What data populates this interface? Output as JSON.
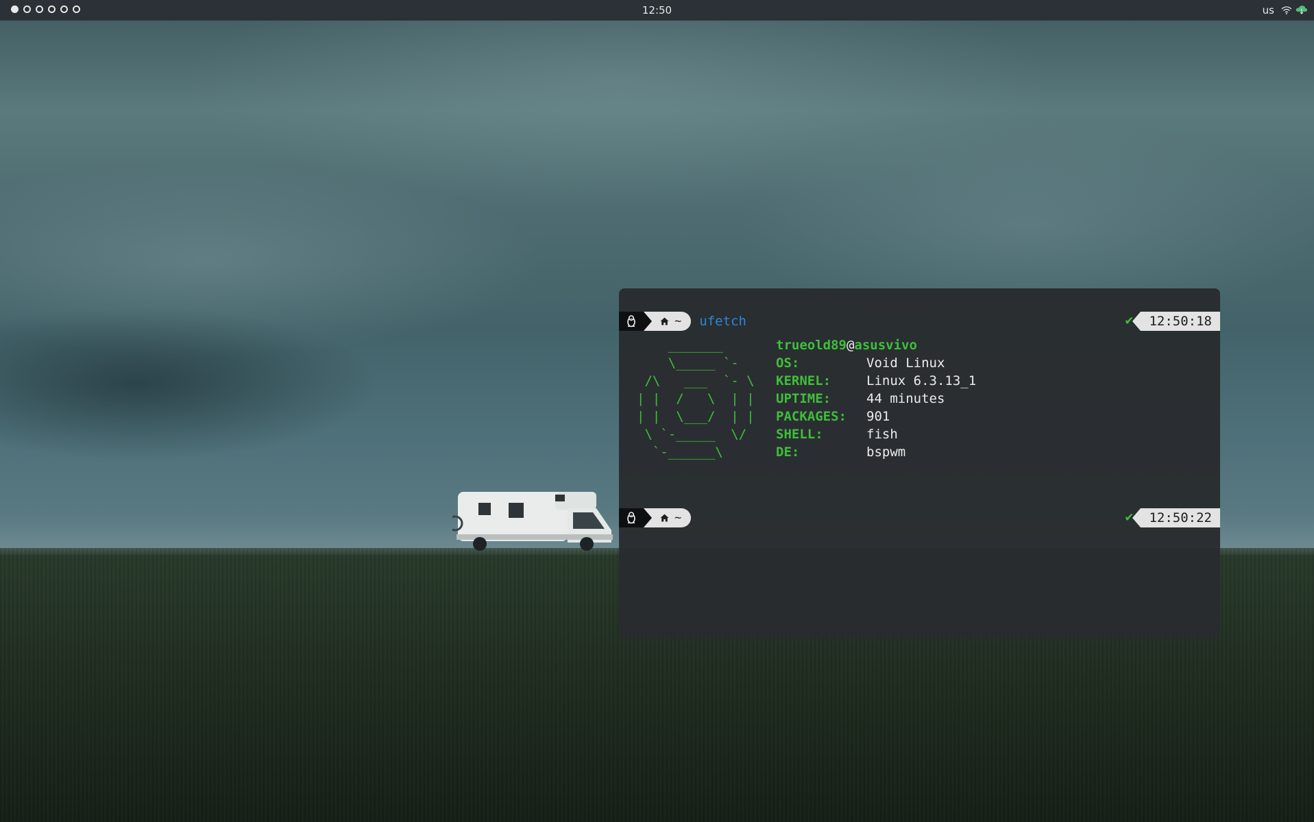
{
  "topbar": {
    "workspaces": [
      {
        "active": true
      },
      {
        "active": false
      },
      {
        "active": false
      },
      {
        "active": false
      },
      {
        "active": false
      },
      {
        "active": false
      }
    ],
    "clock": "12:50",
    "keyboard_layout": "us",
    "tray_icons": [
      "wifi-icon",
      "cloud-icon"
    ]
  },
  "terminal": {
    "prompt1": {
      "os_icon": "linux-penguin-icon",
      "home_icon": "home-icon",
      "dir": "~",
      "command": "ufetch",
      "status": "✔",
      "time": "12:50:18"
    },
    "fetch": {
      "ascii_logo": "    _______\n    \\_____ `-\n /\\   ___  `- \\\n| |  /   \\  | |\n| |  \\___/  | |\n \\ `-_____  \\/\n  `-______\\",
      "user": "trueold89",
      "at": "@",
      "host": "asusvivo",
      "fields": [
        {
          "key": "OS:",
          "value": "Void Linux"
        },
        {
          "key": "KERNEL:",
          "value": "Linux 6.3.13_1"
        },
        {
          "key": "UPTIME:",
          "value": "44 minutes"
        },
        {
          "key": "PACKAGES:",
          "value": "901"
        },
        {
          "key": "SHELL:",
          "value": "fish"
        },
        {
          "key": "DE:",
          "value": "bspwm"
        }
      ]
    },
    "prompt2": {
      "os_icon": "linux-penguin-icon",
      "home_icon": "home-icon",
      "dir": "~",
      "status": "✔",
      "time": "12:50:22"
    }
  },
  "colors": {
    "accent_green": "#3fbf3a",
    "command_blue": "#2f86d6",
    "terminal_bg": "#292c2f",
    "bar_bg": "#2b3136"
  }
}
